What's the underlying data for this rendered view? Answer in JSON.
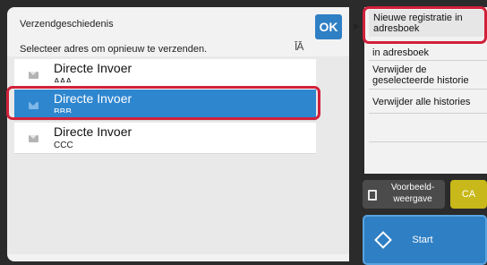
{
  "header": {
    "title": "Verzendgeschiedenis",
    "ok_label": "OK",
    "subtitle": "Selecteer adres om opnieuw te verzenden.",
    "sort_icon": "sort-icon"
  },
  "history": [
    {
      "name": "Directe Invoer",
      "sub": "AAA",
      "selected": false
    },
    {
      "name": "Directe Invoer",
      "sub": "BBB",
      "selected": true
    },
    {
      "name": "Directe Invoer",
      "sub": "CCC",
      "selected": false
    }
  ],
  "menu": {
    "items": [
      "Nieuwe registratie in adresboek",
      "in adresboek",
      "Verwijder de geselecteerde historie",
      "Verwijder alle histories"
    ]
  },
  "buttons": {
    "preview": "Voorbeeld-weergave",
    "ca": "CA",
    "start": "Start"
  },
  "colors": {
    "accent": "#2f7fc4",
    "selection": "#2e86cf",
    "highlight_outline": "#d1213a",
    "ca": "#c8b81a"
  }
}
